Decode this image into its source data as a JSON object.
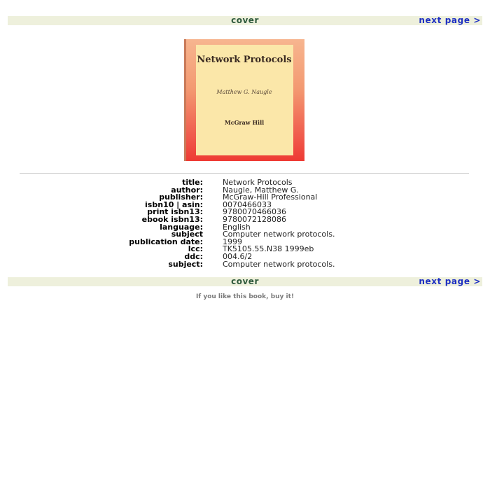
{
  "nav": {
    "title": "cover",
    "next_label": "next page >"
  },
  "cover": {
    "title": "Network Protocols",
    "author": "Matthew G. Naugle",
    "publisher": "McGraw Hill"
  },
  "metadata": [
    {
      "label": "title:",
      "value": "Network Protocols"
    },
    {
      "label": "author:",
      "value": "Naugle, Matthew G."
    },
    {
      "label": "publisher:",
      "value": "McGraw-Hill Professional"
    },
    {
      "label": "isbn10 | asin:",
      "value": "0070466033"
    },
    {
      "label": "print isbn13:",
      "value": "9780070466036"
    },
    {
      "label": "ebook isbn13:",
      "value": "9780072128086"
    },
    {
      "label": "language:",
      "value": "English"
    },
    {
      "label": "subject",
      "value": "Computer network protocols."
    },
    {
      "label": "publication date:",
      "value": "1999"
    },
    {
      "label": "lcc:",
      "value": "TK5105.55.N38 1999eb"
    },
    {
      "label": "ddc:",
      "value": "004.6/2"
    },
    {
      "label": "subject:",
      "value": "Computer network protocols."
    }
  ],
  "footer": {
    "buy_text": "If you like this book, buy it!"
  }
}
